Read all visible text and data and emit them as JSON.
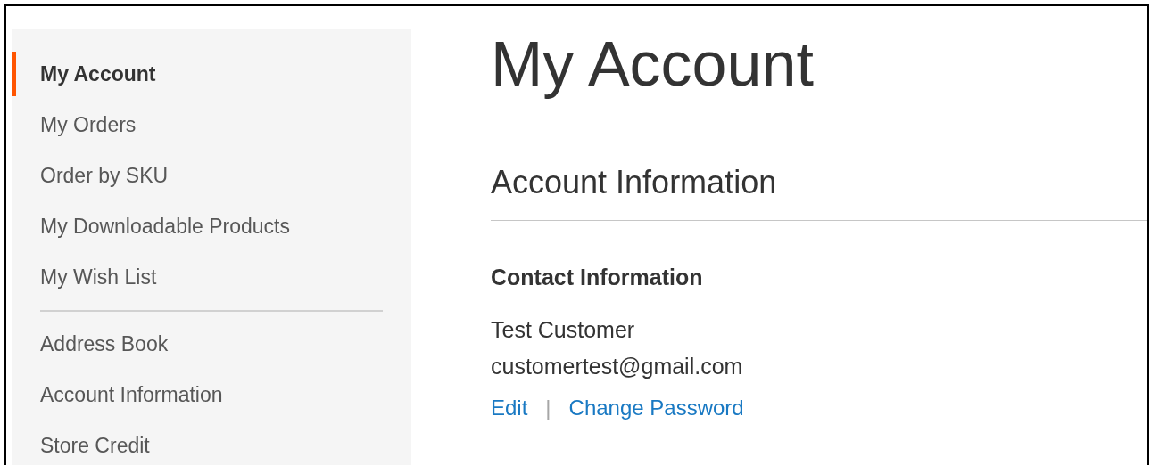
{
  "sidebar": {
    "sections": [
      {
        "items": [
          {
            "label": "My Account",
            "selected": true
          },
          {
            "label": "My Orders",
            "selected": false
          },
          {
            "label": "Order by SKU",
            "selected": false
          },
          {
            "label": "My Downloadable Products",
            "selected": false
          },
          {
            "label": "My Wish List",
            "selected": false
          }
        ]
      },
      {
        "items": [
          {
            "label": "Address Book",
            "selected": false
          },
          {
            "label": "Account Information",
            "selected": false
          },
          {
            "label": "Store Credit",
            "selected": false
          }
        ]
      }
    ]
  },
  "page_title": "My Account",
  "section_title": "Account Information",
  "contact": {
    "title": "Contact Information",
    "name": "Test Customer",
    "email": "customertest@gmail.com",
    "links": [
      {
        "kind": "link",
        "text": "Edit"
      },
      {
        "kind": "separator",
        "text": "|"
      },
      {
        "kind": "link",
        "text": "Change Password"
      }
    ]
  }
}
